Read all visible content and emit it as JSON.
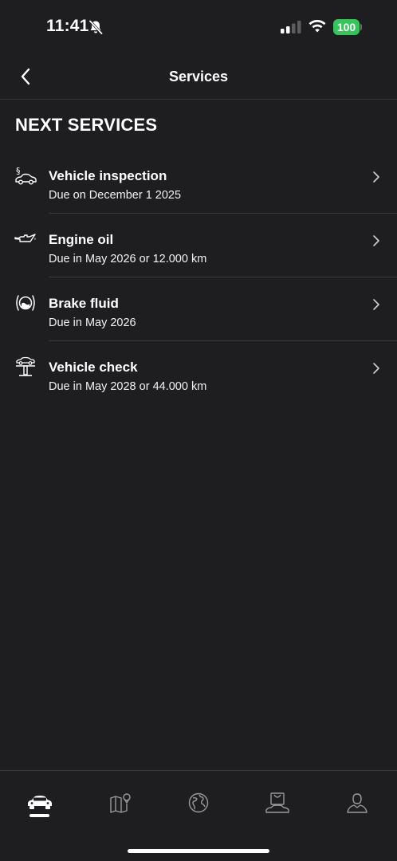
{
  "status_bar": {
    "time": "11:41",
    "battery": "100",
    "battery_color": "#33c659",
    "icons": [
      "bell-slash-icon",
      "signal-icon",
      "wifi-icon",
      "battery-icon"
    ]
  },
  "nav": {
    "back_icon": "chevron-left-icon",
    "title": "Services"
  },
  "section": {
    "title": "NEXT SERVICES"
  },
  "services": [
    {
      "icon": "vehicle-inspection-icon",
      "title": "Vehicle inspection",
      "subtitle": "Due on December 1 2025"
    },
    {
      "icon": "engine-oil-icon",
      "title": "Engine oil",
      "subtitle": "Due in May 2026 or 12.000 km"
    },
    {
      "icon": "brake-fluid-icon",
      "title": "Brake fluid",
      "subtitle": "Due in May 2026"
    },
    {
      "icon": "vehicle-check-icon",
      "title": "Vehicle check",
      "subtitle": "Due in May 2028 or 44.000 km"
    }
  ],
  "tab_bar": {
    "tabs": [
      "car-icon",
      "map-icon",
      "globe-icon",
      "shop-icon",
      "profile-icon"
    ],
    "active": "car-icon"
  },
  "colors": {
    "background": "#1e1e20",
    "divider": "#3a3a3d",
    "text": "#ffffff"
  }
}
